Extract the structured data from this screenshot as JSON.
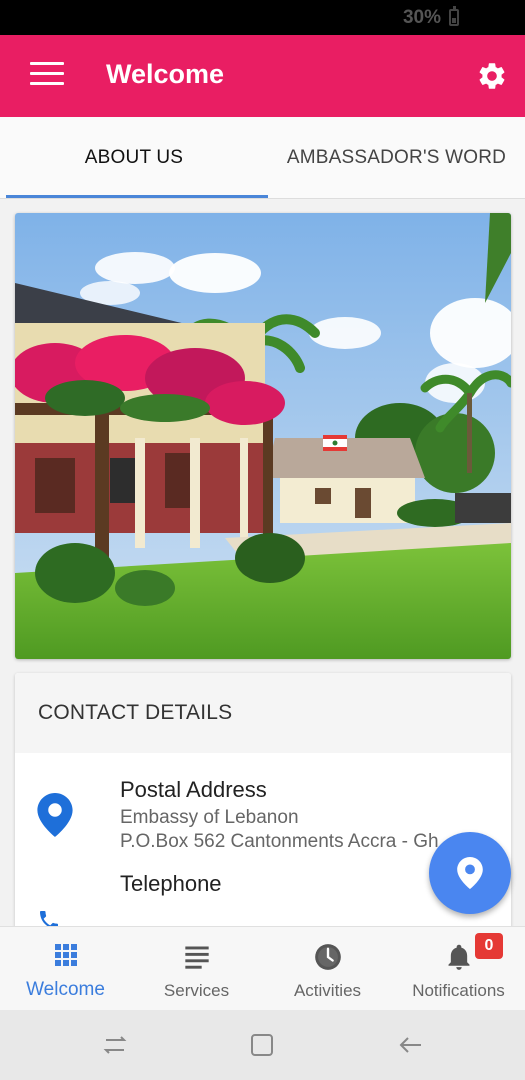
{
  "status_bar": {
    "battery": "30%"
  },
  "app_bar": {
    "title": "Welcome",
    "menu_icon": "hamburger-menu-icon",
    "settings_icon": "gear-icon",
    "color": "#e91e63"
  },
  "tabs": [
    {
      "label": "ABOUT US",
      "active": true
    },
    {
      "label": "AMBASSADOR'S WORD",
      "active": false
    }
  ],
  "tab_indicator_color": "#4a86d8",
  "contact": {
    "header": "CONTACT DETAILS",
    "postal": {
      "title": "Postal Address",
      "line1": "Embassy of Lebanon",
      "line2": "P.O.Box 562 Cantonments Accra - Gh"
    },
    "telephone": {
      "title": "Telephone"
    }
  },
  "fab_icon": "location-pin-icon",
  "bottom_nav": {
    "items": [
      {
        "label": "Welcome",
        "icon": "grid-icon",
        "active": true
      },
      {
        "label": "Services",
        "icon": "list-icon",
        "active": false
      },
      {
        "label": "Activities",
        "icon": "clock-icon",
        "active": false
      },
      {
        "label": "Notifications",
        "icon": "bell-icon",
        "active": false
      }
    ],
    "notifications_badge": "0",
    "active_color": "#3b7ddd"
  }
}
